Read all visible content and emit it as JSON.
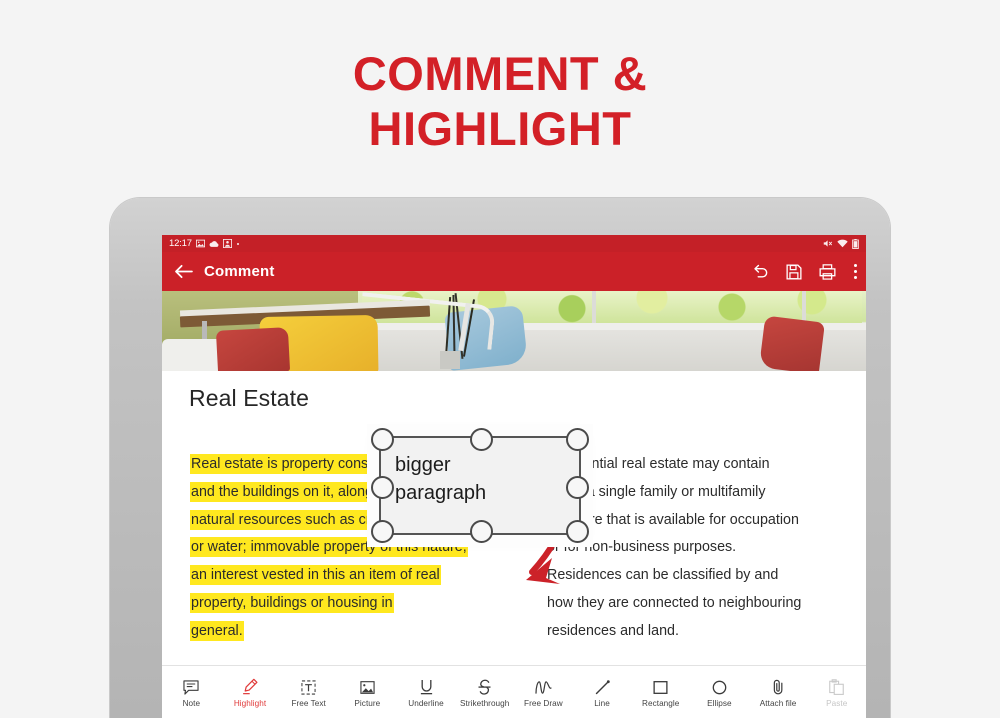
{
  "promo": {
    "line1": "COMMENT &",
    "line2": "HIGHLIGHT",
    "color": "#d32027"
  },
  "status_bar": {
    "time": "12:17",
    "left_icons": [
      "image-icon",
      "cloud-icon",
      "contact-icon",
      "more-dot-icon"
    ],
    "right_icons": [
      "mute-icon",
      "wifi-icon",
      "battery-icon"
    ],
    "background": "#c42027"
  },
  "app_bar": {
    "back_icon": "arrow-left-icon",
    "title": "Comment",
    "background": "#cb2128",
    "actions": [
      {
        "name": "undo-button",
        "icon": "undo-icon"
      },
      {
        "name": "save-button",
        "icon": "floppy-disk-icon"
      },
      {
        "name": "print-button",
        "icon": "printer-icon"
      },
      {
        "name": "overflow-menu-button",
        "icon": "vertical-dots-icon"
      }
    ]
  },
  "document": {
    "title": "Real Estate",
    "banner_alt": "living-room-photo",
    "highlight_color": "#ffe81f",
    "left_column_lines": [
      "Real estate is property consisting of land",
      "and the buildings on it, along with its",
      "natural resources such as crops, minerals",
      "or water; immovable property of this nature;",
      "an interest vested in this an item of real",
      "property, buildings or housing in",
      "general."
    ],
    "right_column_lines": [
      "Residential real estate may contain",
      "either a single family or multifamily",
      "structure that is available for occupation",
      "or for non-business purposes.",
      "Residences can be classified by and",
      "how they are connected to neighbouring",
      "residences and land."
    ]
  },
  "annotation": {
    "textbox_text": "bigger\nparagraph",
    "textbox_line1": "bigger",
    "textbox_line2": "paragraph",
    "arrow_color": "#cc2229",
    "handles": 8
  },
  "toolbar": {
    "items": [
      {
        "label": "Note",
        "icon": "note-comment-icon",
        "state": "normal"
      },
      {
        "label": "Highlight",
        "icon": "highlighter-icon",
        "state": "active"
      },
      {
        "label": "Free Text",
        "icon": "text-box-icon",
        "state": "normal"
      },
      {
        "label": "Picture",
        "icon": "picture-icon",
        "state": "normal"
      },
      {
        "label": "Underline",
        "icon": "underline-icon",
        "state": "normal"
      },
      {
        "label": "Strikethrough",
        "icon": "strikethrough-icon",
        "state": "normal"
      },
      {
        "label": "Free Draw",
        "icon": "free-draw-icon",
        "state": "normal"
      },
      {
        "label": "Line",
        "icon": "line-icon",
        "state": "normal"
      },
      {
        "label": "Rectangle",
        "icon": "rectangle-icon",
        "state": "normal"
      },
      {
        "label": "Ellipse",
        "icon": "ellipse-icon",
        "state": "normal"
      },
      {
        "label": "Attach file",
        "icon": "paperclip-icon",
        "state": "normal"
      },
      {
        "label": "Paste",
        "icon": "paste-icon",
        "state": "disabled"
      }
    ]
  }
}
